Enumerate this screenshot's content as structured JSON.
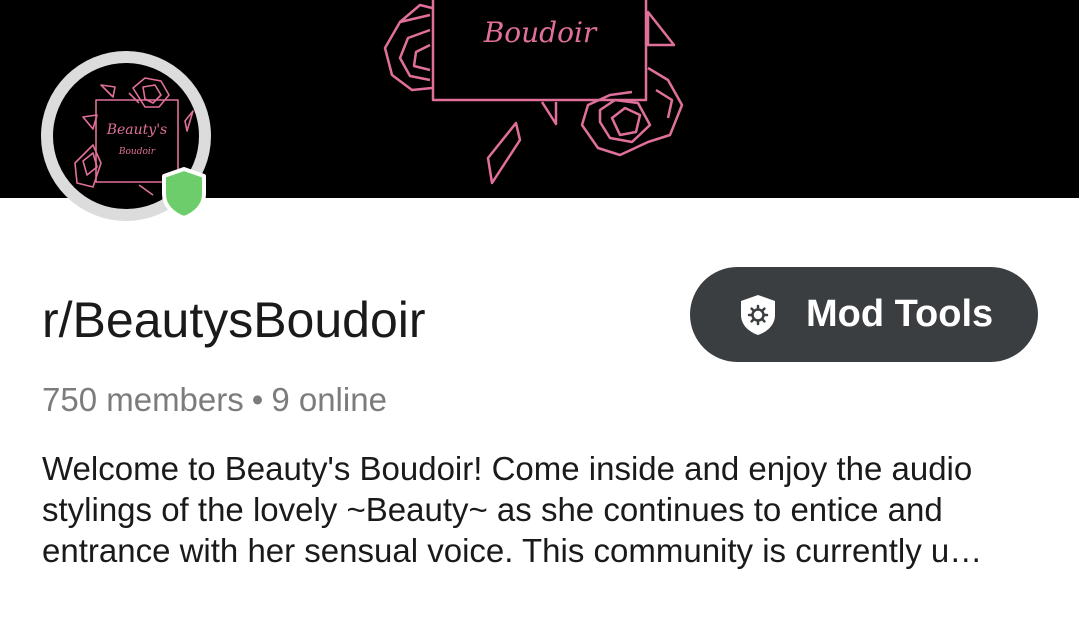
{
  "banner": {
    "text": "Boudoir",
    "accent_color": "#e0709a",
    "background_color": "#000000"
  },
  "avatar": {
    "text_line1": "Beauty's",
    "text_line2": "Boudoir",
    "moderator_badge_color": "#6ccd6a"
  },
  "community": {
    "name": "r/BeautysBoudoir",
    "members": "750 members",
    "separator": "•",
    "online": "9 online",
    "description": "Welcome to Beauty's Boudoir! Come inside and enjoy the audio stylings of the lovely ~Beauty~ as she continues to entice and entrance with her sensual voice. This community is currently u…"
  },
  "mod_tools": {
    "label": "Mod Tools",
    "icon": "shield-gear-icon",
    "background_color": "#3a3e40"
  }
}
